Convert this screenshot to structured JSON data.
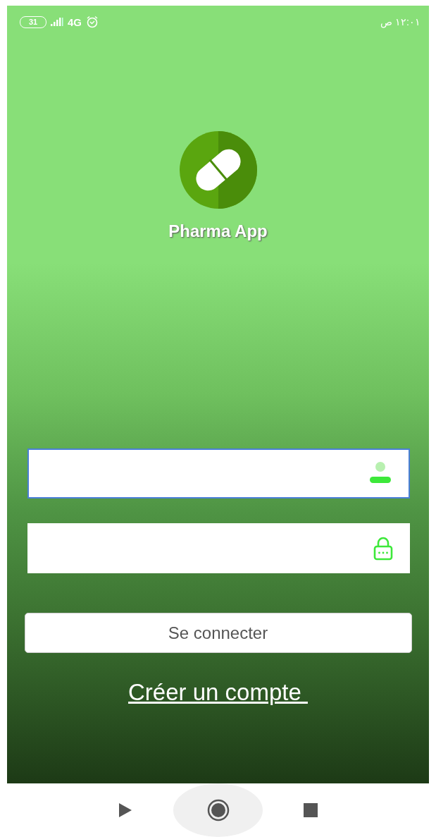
{
  "status_bar": {
    "battery": "31",
    "network": "4G",
    "time": "١٢:٠١ ص"
  },
  "app": {
    "title": "Pharma App"
  },
  "fields": [
    {
      "kind": "user",
      "focused": true
    },
    {
      "kind": "password",
      "focused": false
    }
  ],
  "login_button": {
    "label": "Se connecter"
  },
  "signup_link": {
    "label": "Créer un compte "
  }
}
